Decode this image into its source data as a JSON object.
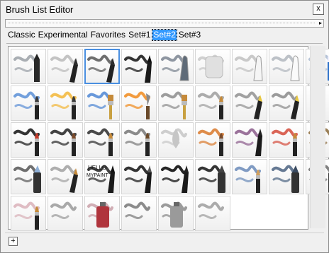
{
  "window": {
    "title": "Brush List Editor",
    "close_label": "x"
  },
  "toolbar": {
    "arrow": "▸"
  },
  "tabs": [
    {
      "label": "Classic",
      "selected": false
    },
    {
      "label": "Experimental",
      "selected": false
    },
    {
      "label": "Favorites",
      "selected": false
    },
    {
      "label": "Set#1",
      "selected": false
    },
    {
      "label": "Set#2",
      "selected": true
    },
    {
      "label": "Set#3",
      "selected": false
    }
  ],
  "colors": {
    "selection": "#3399ff",
    "selected_tile_border": "#4a8fe0"
  },
  "brush_grid": {
    "selected_index": 2,
    "tiles": [
      {
        "icon": "charcoal-smear-icon",
        "stroke": "#9aa0a6",
        "tool": "charcoal",
        "tip": "#222"
      },
      {
        "icon": "pencil-smudge-icon",
        "stroke": "#b9b9b9",
        "tool": "pencil",
        "tip": "#2b2b2b"
      },
      {
        "icon": "pencil-sketch-eye-icon",
        "stroke": "#555555",
        "tool": "pencil",
        "tip": "#2b2b2b"
      },
      {
        "icon": "ink-cube-sketch-icon",
        "stroke": "#111111",
        "tool": "pen",
        "tip": "#111"
      },
      {
        "icon": "graphite-stick-icon",
        "stroke": "#7a8490",
        "tool": "stick",
        "tip": "#5f6b78"
      },
      {
        "icon": "soft-eraser-icon",
        "stroke": "#c8c8c8",
        "tool": "block",
        "tip": "#e0e0e0"
      },
      {
        "icon": "chalk-stick-icon",
        "stroke": "#c0c0c0",
        "tool": "chalk",
        "tip": "#f5f5f5"
      },
      {
        "icon": "white-chalk-icon",
        "stroke": "#b0b6bd",
        "tool": "chalk",
        "tip": "#fafafa"
      },
      {
        "icon": "eraser-block-icon",
        "stroke": "#a8b8d0",
        "tool": "eraser",
        "tip": "#2a6fc9"
      },
      {
        "icon": "blue-watercolor-icon",
        "stroke": "#5b8fd6",
        "tool": "brush",
        "tip": "#3b3b3b"
      },
      {
        "icon": "yellow-watercolor-icon",
        "stroke": "#f2b637",
        "tool": "brush",
        "tip": "#3b3b3b"
      },
      {
        "icon": "blue-flat-brush-icon",
        "stroke": "#4d86d3",
        "tool": "flatbrush",
        "tip": "#c58a3a"
      },
      {
        "icon": "orange-palette-knife-icon",
        "stroke": "#f08a1c",
        "tool": "knife",
        "tip": "#8a8a8a"
      },
      {
        "icon": "gray-zigzag-brush-icon",
        "stroke": "#8c8c8c",
        "tool": "flatbrush",
        "tip": "#c58a3a"
      },
      {
        "icon": "gray-wash-brush-icon",
        "stroke": "#9e9e9e",
        "tool": "brush",
        "tip": "#c58a3a"
      },
      {
        "icon": "pencil-hatching-icon",
        "stroke": "#909090",
        "tool": "pencil",
        "tip": "#e8c840"
      },
      {
        "icon": "crosshatch-pencil-icon",
        "stroke": "#8a8a8a",
        "tool": "pencil",
        "tip": "#e8c840"
      },
      {
        "icon": "empty-tile",
        "stroke": "#ffffff",
        "tool": "none",
        "tip": "#fff"
      },
      {
        "icon": "ink-swirl-brush-icon",
        "stroke": "#111111",
        "tool": "brush",
        "tip": "#c43a2a"
      },
      {
        "icon": "ink-scribble-brush-icon",
        "stroke": "#222222",
        "tool": "brush",
        "tip": "#7a4a2a"
      },
      {
        "icon": "ink-loop-brush-icon",
        "stroke": "#2a2a2a",
        "tool": "brush",
        "tip": "#c58a3a"
      },
      {
        "icon": "airbrush-gray-icon",
        "stroke": "#777777",
        "tool": "brush",
        "tip": "#6b4a2a"
      },
      {
        "icon": "soft-gray-blur-icon",
        "stroke": "#c6c6c6",
        "tool": "drop",
        "tip": "#c6c6c6"
      },
      {
        "icon": "oil-orange-brush-icon",
        "stroke": "#d8782a",
        "tool": "brush",
        "tip": "#7a4a2a"
      },
      {
        "icon": "purple-oil-brush-icon",
        "stroke": "#8a5a8a",
        "tool": "pen",
        "tip": "#222"
      },
      {
        "icon": "red-oil-brush-icon",
        "stroke": "#d44a3a",
        "tool": "brush",
        "tip": "#c58a3a"
      },
      {
        "icon": "brown-texture-sponge-icon",
        "stroke": "#8a6a3a",
        "tool": "brush",
        "tip": "#5a5a5a"
      },
      {
        "icon": "gray-marker-strokes-icon",
        "stroke": "#555555",
        "tool": "marker",
        "tip": "#8fb0d8"
      },
      {
        "icon": "gray-swirl-pencil-icon",
        "stroke": "#a0a0a0",
        "tool": "pencil",
        "tip": "#c58a3a"
      },
      {
        "icon": "hello-mypaint-pen-icon",
        "stroke": "#222222",
        "tool": "pen",
        "tip": "#111"
      },
      {
        "icon": "ink-ribbon-pen-icon",
        "stroke": "#111111",
        "tool": "pen",
        "tip": "#555"
      },
      {
        "icon": "ink-calligraphy-pen-icon",
        "stroke": "#000000",
        "tool": "pen",
        "tip": "#222"
      },
      {
        "icon": "black-blob-marker-icon",
        "stroke": "#111111",
        "tool": "marker",
        "tip": "#444"
      },
      {
        "icon": "blue-felt-marker-icon",
        "stroke": "#6a8ab8",
        "tool": "brush",
        "tip": "#d0a060"
      },
      {
        "icon": "navy-marker-icon",
        "stroke": "#4a6280",
        "tool": "marker",
        "tip": "#3a4a60"
      },
      {
        "icon": "dark-gray-marker-icon",
        "stroke": "#6a6a6a",
        "tool": "marker",
        "tip": "#444"
      },
      {
        "icon": "pink-soft-brush-icon",
        "stroke": "#d9b0b8",
        "tool": "brush",
        "tip": "#c58a3a"
      },
      {
        "icon": "speckle-spray-icon",
        "stroke": "#9a9a9a",
        "tool": "none",
        "tip": "#fff"
      },
      {
        "icon": "red-spray-can-icon",
        "stroke": "#c9a0a8",
        "tool": "can",
        "tip": "#b0343c"
      },
      {
        "icon": "gray-spray-dots-icon",
        "stroke": "#777777",
        "tool": "none",
        "tip": "#fff"
      },
      {
        "icon": "silver-spray-can-icon",
        "stroke": "#8a8a8a",
        "tool": "can",
        "tip": "#9a9a9a"
      },
      {
        "icon": "soft-smoke-icon",
        "stroke": "#9c9c9c",
        "tool": "none",
        "tip": "#fff"
      }
    ]
  },
  "footer": {
    "add_label": "+"
  }
}
